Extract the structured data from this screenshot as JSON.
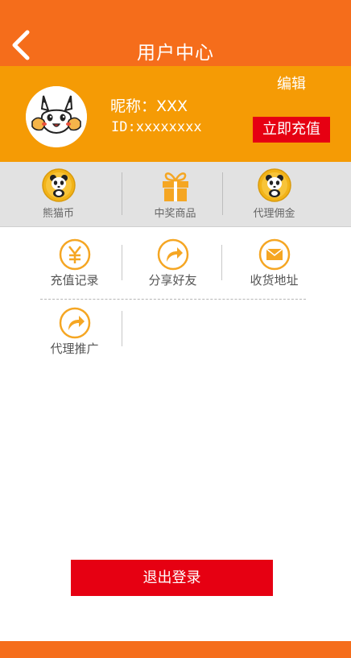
{
  "header": {
    "title": "用户中心",
    "back_icon": "chevron-left-icon",
    "background": "#f56d1b"
  },
  "profile": {
    "edit_label": "编辑",
    "nickname": "昵称：XXX",
    "user_id": "ID:xxxxxxxx",
    "recharge_label": "立即充值",
    "background": "#f59b05",
    "accent": "#e60012"
  },
  "stats": [
    {
      "label": "熊猫币",
      "icon": "panda-coin-icon"
    },
    {
      "label": "中奖商品",
      "icon": "gift-icon"
    },
    {
      "label": "代理佣金",
      "icon": "panda-coin-icon"
    }
  ],
  "menu": [
    {
      "label": "充值记录",
      "icon": "yen-icon"
    },
    {
      "label": "分享好友",
      "icon": "share-icon"
    },
    {
      "label": "收货地址",
      "icon": "envelope-icon"
    },
    {
      "label": "代理推广",
      "icon": "share-icon"
    }
  ],
  "logout": {
    "label": "退出登录"
  }
}
